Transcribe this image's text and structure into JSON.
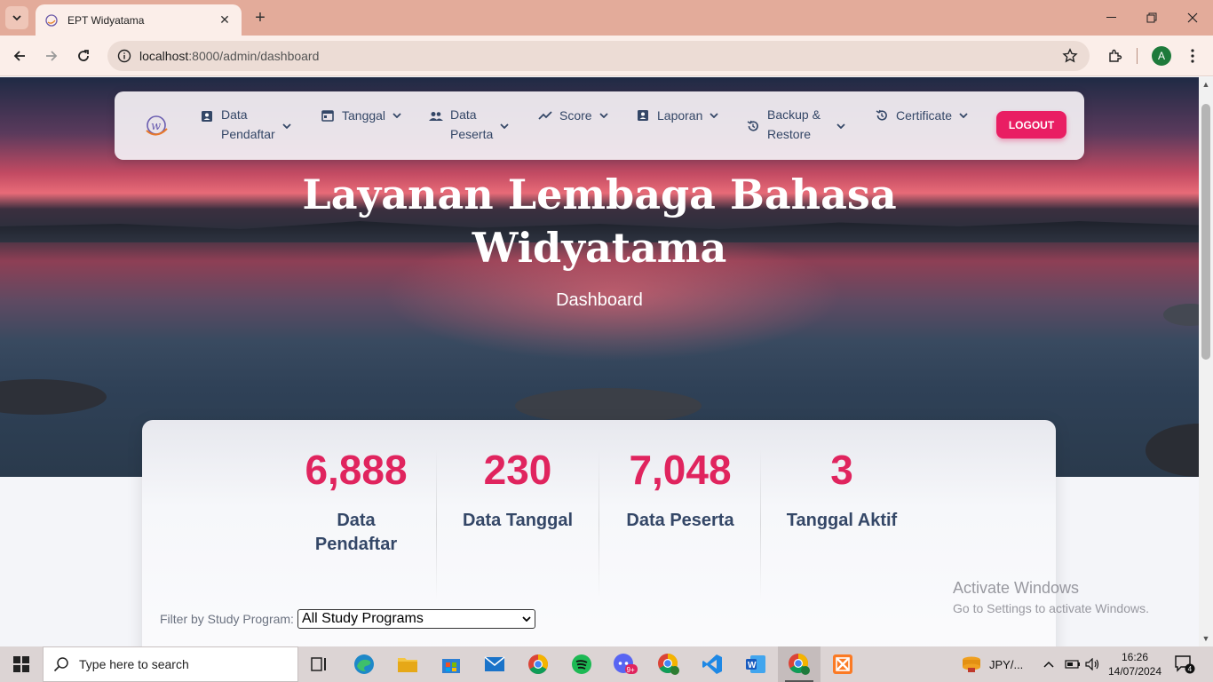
{
  "browser": {
    "tab_title": "EPT Widyatama",
    "url_host": "localhost",
    "url_path": ":8000/admin/dashboard",
    "profile_initial": "A"
  },
  "navbar": {
    "items": [
      {
        "line1": "Data",
        "line2": "Pendaftar",
        "icon": "contact-card-icon"
      },
      {
        "line1": "Tanggal",
        "line2": "",
        "icon": "calendar-icon"
      },
      {
        "line1": "Data",
        "line2": "Peserta",
        "icon": "people-icon"
      },
      {
        "line1": "Score",
        "line2": "",
        "icon": "trending-up-icon"
      },
      {
        "line1": "Laporan",
        "line2": "",
        "icon": "report-icon"
      },
      {
        "line1": "Backup &",
        "line2": "Restore",
        "icon": "restore-icon"
      },
      {
        "line1": "Certificate",
        "line2": "",
        "icon": "history-icon"
      }
    ],
    "logout_label": "LOGOUT"
  },
  "hero": {
    "title_line1": "Layanan Lembaga Bahasa",
    "title_line2": "Widyatama",
    "subtitle": "Dashboard"
  },
  "stats": [
    {
      "value": "6,888",
      "label": "Data Pendaftar"
    },
    {
      "value": "230",
      "label": "Data Tanggal"
    },
    {
      "value": "7,048",
      "label": "Data Peserta"
    },
    {
      "value": "3",
      "label": "Tanggal Aktif"
    }
  ],
  "filter": {
    "label": "Filter by Study Program:",
    "selected": "All Study Programs"
  },
  "watermark": {
    "line1": "Activate Windows",
    "line2": "Go to Settings to activate Windows."
  },
  "taskbar": {
    "search_placeholder": "Type here to search",
    "tray_label": "JPY/...",
    "time": "16:26",
    "date": "14/07/2024",
    "notification_count": "4",
    "mail_badge": "9+"
  },
  "colors": {
    "accent": "#e91e63",
    "stat_value": "#e0245e",
    "nav_text": "#344767",
    "tab_strip": "#e3ab9a"
  }
}
